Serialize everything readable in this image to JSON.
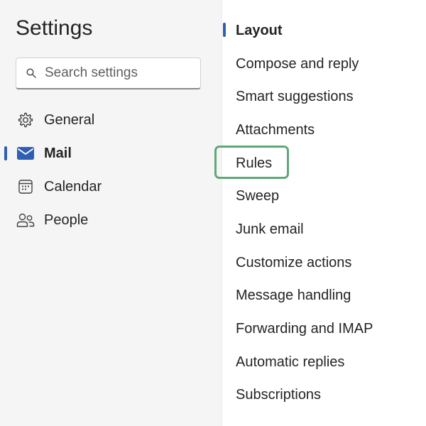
{
  "header": {
    "title": "Settings"
  },
  "search": {
    "placeholder": "Search settings",
    "icon": "search-icon"
  },
  "sidebar": {
    "accent_color": "#2f5fb3",
    "items": [
      {
        "label": "General",
        "icon": "gear-icon",
        "active": false
      },
      {
        "label": "Mail",
        "icon": "mail-icon",
        "active": true
      },
      {
        "label": "Calendar",
        "icon": "calendar-icon",
        "active": false
      },
      {
        "label": "People",
        "icon": "people-icon",
        "active": false
      }
    ]
  },
  "mail_settings": {
    "highlight_color": "#5fa87a",
    "highlighted_item": "Rules",
    "items": [
      {
        "label": "Layout",
        "active": true
      },
      {
        "label": "Compose and reply",
        "active": false
      },
      {
        "label": "Smart suggestions",
        "active": false
      },
      {
        "label": "Attachments",
        "active": false
      },
      {
        "label": "Rules",
        "active": false
      },
      {
        "label": "Sweep",
        "active": false
      },
      {
        "label": "Junk email",
        "active": false
      },
      {
        "label": "Customize actions",
        "active": false
      },
      {
        "label": "Message handling",
        "active": false
      },
      {
        "label": "Forwarding and IMAP",
        "active": false
      },
      {
        "label": "Automatic replies",
        "active": false
      },
      {
        "label": "Subscriptions",
        "active": false
      }
    ]
  }
}
